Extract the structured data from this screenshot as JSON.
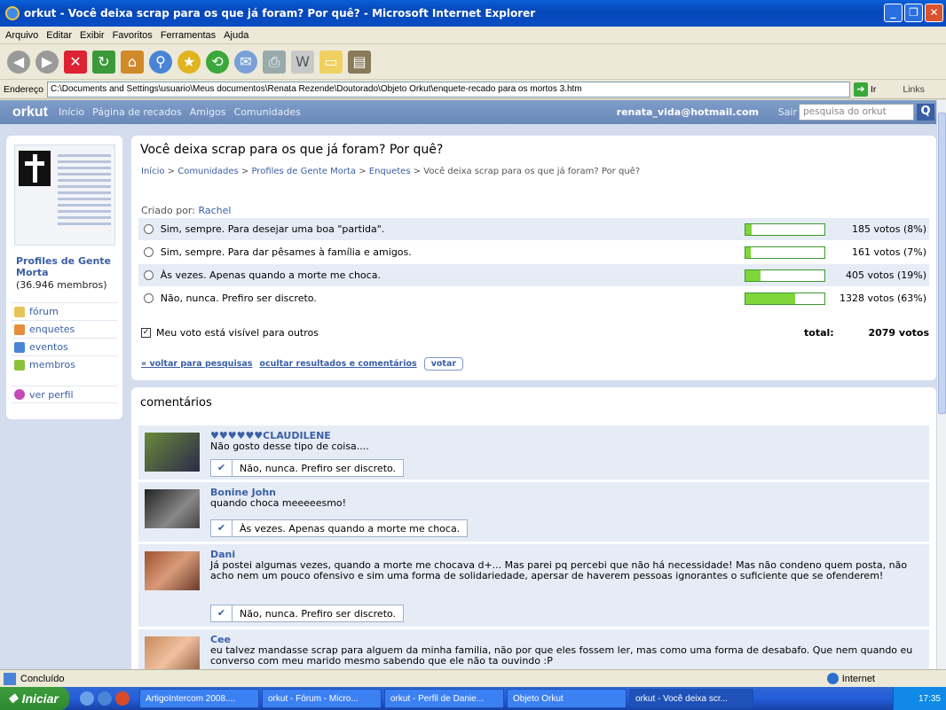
{
  "window": {
    "title": "orkut - Você deixa scrap para os que já foram? Por quê? - Microsoft Internet Explorer"
  },
  "menu": [
    "Arquivo",
    "Editar",
    "Exibir",
    "Favoritos",
    "Ferramentas",
    "Ajuda"
  ],
  "address": {
    "label": "Endereço",
    "url": "C:\\Documents and Settings\\usuario\\Meus documentos\\Renata Rezende\\Doutorado\\Objeto Orkut\\enquete-recado para os mortos 3.htm",
    "go": "Ir",
    "links": "Links"
  },
  "orkut": {
    "logo": "orkut",
    "nav": [
      "Início",
      "Página de recados",
      "Amigos",
      "Comunidades"
    ],
    "user_email": "renata_vida@hotmail.com",
    "sair": "Sair",
    "search_placeholder": "pesquisa do orkut"
  },
  "community": {
    "name": "Profiles de Gente Morta",
    "members": "(36.946 membros)",
    "links": [
      {
        "label": "fórum",
        "color": "#e8c25a"
      },
      {
        "label": "enquetes",
        "color": "#e88e3a"
      },
      {
        "label": "eventos",
        "color": "#4a84d6"
      },
      {
        "label": "membros",
        "color": "#8cc03a"
      }
    ],
    "ver_perfil": "ver perfil"
  },
  "poll": {
    "title": "Você deixa scrap para os que já foram? Por quê?",
    "breadcrumb": [
      "Início",
      "Comunidades",
      "Profiles de Gente Morta",
      "Enquetes",
      "Você deixa scrap para os que já foram? Por quê?"
    ],
    "created_by_label": "Criado por:",
    "created_by": "Rachel",
    "options": [
      {
        "text": "Sim, sempre. Para desejar uma boa \"partida\".",
        "votes": "185 votos (8%)",
        "pct": 8
      },
      {
        "text": "Sim, sempre. Para dar pêsames à família e amigos.",
        "votes": "161 votos (7%)",
        "pct": 7
      },
      {
        "text": "Às vezes. Apenas quando a morte me choca.",
        "votes": "405 votos (19%)",
        "pct": 19
      },
      {
        "text": "Não, nunca. Prefiro ser discreto.",
        "votes": "1328 votos (63%)",
        "pct": 63
      }
    ],
    "visible_label": "Meu voto está visível para outros",
    "total_label": "total:",
    "total": "2079 votos",
    "back_link": "« voltar para pesquisas",
    "hide_link": "ocultar resultados e comentários",
    "vote_button": "votar"
  },
  "comments": {
    "heading": "comentários",
    "items": [
      {
        "name": "♥♥♥♥♥♥CLAUDILENE",
        "text": "Não gosto desse tipo de coisa....",
        "vote": "Não, nunca. Prefiro ser discreto."
      },
      {
        "name": "Bonine John",
        "text": "quando choca meeeeesmo!",
        "vote": "Às vezes. Apenas quando a morte me choca."
      },
      {
        "name": "Dani",
        "text": "Já postei algumas vezes, quando a morte me chocava d+... Mas parei pq percebi que não há necessidade! Mas não condeno quem posta, não acho nem um pouco ofensivo e sim uma forma de solidariedade, apersar de haverem pessoas ignorantes o suficiente que se ofenderem!",
        "vote": "Não, nunca. Prefiro ser discreto."
      },
      {
        "name": "Cee",
        "text": "eu talvez mandasse scrap para alguem da minha familia, não por que eles fossem ler, mas como uma forma de desabafo. Que nem quando eu converso com meu marido mesmo sabendo que ele não ta ouvindo :P"
      }
    ]
  },
  "status": {
    "text": "Concluído",
    "zone": "Internet"
  },
  "taskbar": {
    "start": "Iniciar",
    "tasks": [
      "ArtigoIntercom 2008....",
      "orkut - Fórum - Micro...",
      "orkut - Perfil de Danie...",
      "Objeto Orkut",
      "orkut - Você deixa scr..."
    ],
    "clock": "17:35"
  }
}
